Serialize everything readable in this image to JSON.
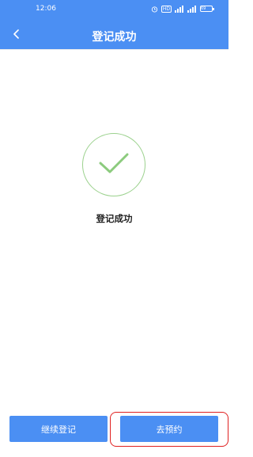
{
  "status_bar": {
    "time": "12:06",
    "hd_badge": "HD",
    "battery": "69"
  },
  "header": {
    "title": "登记成功",
    "back_icon": "chevron-left-icon",
    "background": "#4b8ff3"
  },
  "main": {
    "success_icon": "check-icon",
    "success_color": "#9bd18d",
    "message": "登记成功"
  },
  "footer": {
    "continue_label": "继续登记",
    "book_label": "去预约",
    "highlight_color": "#e02020"
  }
}
